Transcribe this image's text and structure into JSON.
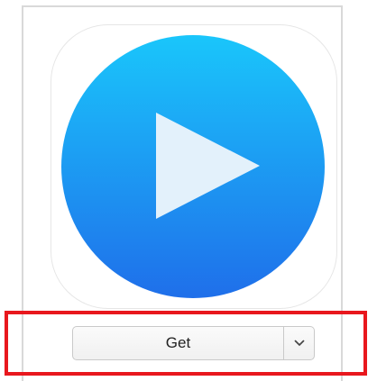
{
  "app": {
    "icon": "play-icon",
    "colors": {
      "gradient_top": "#1ac6fb",
      "gradient_bottom": "#1f6fea",
      "play_glyph": "#e3f1fb"
    }
  },
  "actions": {
    "get_label": "Get",
    "dropdown_icon": "chevron-down-icon"
  },
  "highlight": {
    "color": "#e8171d"
  }
}
